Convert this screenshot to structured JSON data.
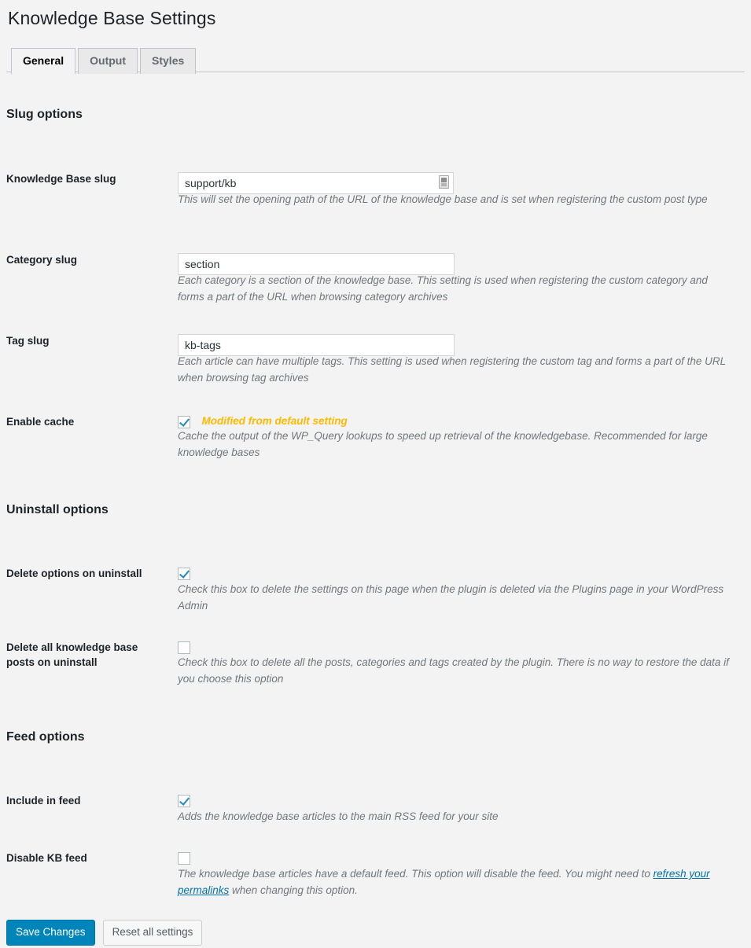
{
  "page": {
    "title": "Knowledge Base Settings"
  },
  "tabs": [
    {
      "label": "General",
      "active": true
    },
    {
      "label": "Output",
      "active": false
    },
    {
      "label": "Styles",
      "active": false
    }
  ],
  "sections": {
    "slug": {
      "heading": "Slug options"
    },
    "uninstall": {
      "heading": "Uninstall options"
    },
    "feed": {
      "heading": "Feed options"
    }
  },
  "fields": {
    "kb_slug": {
      "label": "Knowledge Base slug",
      "value": "support/kb",
      "placeholder": "",
      "description": "This will set the opening path of the URL of the knowledge base and is set when registering the custom post type",
      "icon": "autofill-icon"
    },
    "category_slug": {
      "label": "Category slug",
      "value": "section",
      "placeholder": "",
      "description": "Each category is a section of the knowledge base. This setting is used when registering the custom category and forms a part of the URL when browsing category archives"
    },
    "tag_slug": {
      "label": "Tag slug",
      "value": "kb-tags",
      "placeholder": "",
      "description": "Each article can have multiple tags. This setting is used when registering the custom tag and forms a part of the URL when browsing tag archives"
    },
    "enable_cache": {
      "label": "Enable cache",
      "checked": true,
      "modified_note": "Modified from default setting",
      "description": "Cache the output of the WP_Query lookups to speed up retrieval of the knowledgebase. Recommended for large knowledge bases"
    },
    "delete_options_on_uninstall": {
      "label": "Delete options on uninstall",
      "checked": true,
      "description": "Check this box to delete the settings on this page when the plugin is deleted via the Plugins page in your WordPress Admin"
    },
    "delete_posts_on_uninstall": {
      "label": "Delete all knowledge base posts on uninstall",
      "checked": false,
      "description": "Check this box to delete all the posts, categories and tags created by the plugin. There is no way to restore the data if you choose this option"
    },
    "include_in_feed": {
      "label": "Include in feed",
      "checked": true,
      "description": "Adds the knowledge base articles to the main RSS feed for your site"
    },
    "disable_kb_feed": {
      "label": "Disable KB feed",
      "checked": false,
      "description_before": "The knowledge base articles have a default feed. This option will disable the feed. You might need to ",
      "link_text": "refresh your permalinks",
      "description_after": " when changing this option."
    }
  },
  "actions": {
    "save_label": "Save Changes",
    "reset_label": "Reset all settings"
  },
  "colors": {
    "accent": "#0085ba",
    "link": "#0073aa",
    "warning": "#ffb900",
    "checkmark": "#1e8cbe",
    "background": "#f3f3f3"
  }
}
